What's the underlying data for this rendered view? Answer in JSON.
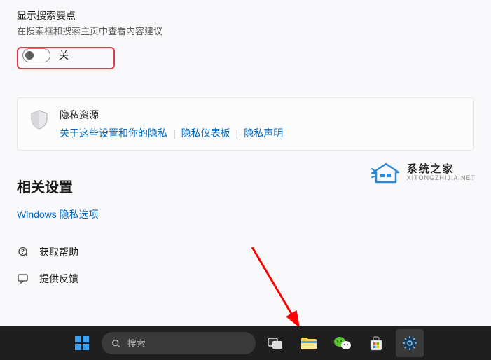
{
  "setting": {
    "title": "显示搜索要点",
    "description": "在搜索框和搜索主页中查看内容建议",
    "toggle_state": "关"
  },
  "privacy": {
    "title": "隐私资源",
    "link1": "关于这些设置和你的隐私",
    "link2": "隐私仪表板",
    "link3": "隐私声明"
  },
  "watermark": {
    "cn": "系统之家",
    "en": "XITONGZHIJIA.NET"
  },
  "related": {
    "header": "相关设置",
    "link": "Windows 隐私选项"
  },
  "help": {
    "item1": "获取帮助",
    "item2": "提供反馈"
  },
  "taskbar": {
    "search_placeholder": "搜索"
  }
}
